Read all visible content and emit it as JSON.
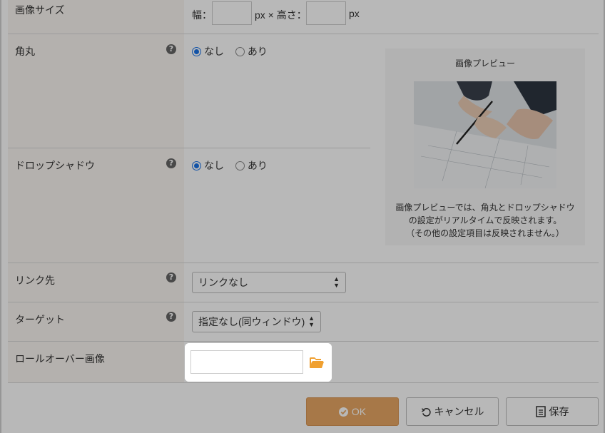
{
  "rows": {
    "image_size": {
      "label": "画像サイズ",
      "width_label": "幅：",
      "unit_x": "px × 高さ：",
      "unit": "px",
      "width_value": "",
      "height_value": ""
    },
    "corner": {
      "label": "角丸",
      "options": [
        "なし",
        "あり"
      ],
      "selected": "なし"
    },
    "drop_shadow": {
      "label": "ドロップシャドウ",
      "options": [
        "なし",
        "あり"
      ],
      "selected": "なし"
    },
    "link": {
      "label": "リンク先",
      "value": "リンクなし"
    },
    "target": {
      "label": "ターゲット",
      "value": "指定なし(同ウィンドウ)"
    },
    "rollover": {
      "label": "ロールオーバー画像",
      "value": ""
    }
  },
  "help_glyph": "?",
  "preview": {
    "title": "画像プレビュー",
    "caption_lines": [
      "画像プレビューでは、角丸とドロップシャドウ",
      "の設定がリアルタイムで反映されます。",
      "（その他の設定項目は反映されません。）"
    ]
  },
  "buttons": {
    "ok": "OK",
    "cancel": "キャンセル",
    "save": "保存"
  },
  "colors": {
    "accent": "#e8a764",
    "radio": "#1a73e8",
    "folder": "#f0a030"
  }
}
